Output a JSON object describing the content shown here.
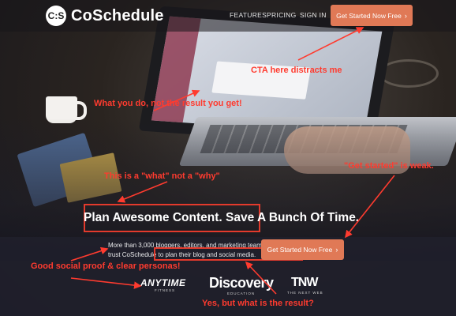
{
  "nav": {
    "logo_mark": "C:S",
    "logo_text": "CoSchedule",
    "items": [
      "FEATURES",
      "PRICING",
      "SIGN IN"
    ],
    "cta": "Get Started Now Free",
    "cta_icon": "chevron-right-icon"
  },
  "hero": {
    "headline_part1": "Plan Awesome Content.",
    "headline_part2": " Save A Bunch Of Time.",
    "subtext_line1": "More than 3,000 bloggers, editors, and marketing teams",
    "subtext_line2_prefix": "trust CoSchedule to ",
    "subtext_line2_highlight": "plan their blog and social media.",
    "cta": "Get Started Now Free"
  },
  "logos": {
    "anytime": "ANYTIME",
    "anytime_sub": "FITNESS",
    "discovery": "Discovery",
    "discovery_sub": "EDUCATION",
    "tnw": "TNW",
    "tnw_sub": "THE NEXT WEB"
  },
  "annotations": {
    "cta_distracts": "CTA here distracts me",
    "what_you_do": "What you do, not the result you get!",
    "what_not_why": "This is a \"what\" not a \"why\"",
    "get_started_weak": "\"Get started\" is weak.",
    "social_proof": "Good social proof & clear personas!",
    "what_result": "Yes, but what is the result?"
  },
  "colors": {
    "accent": "#e07956",
    "annotation": "#ff3b2f"
  }
}
